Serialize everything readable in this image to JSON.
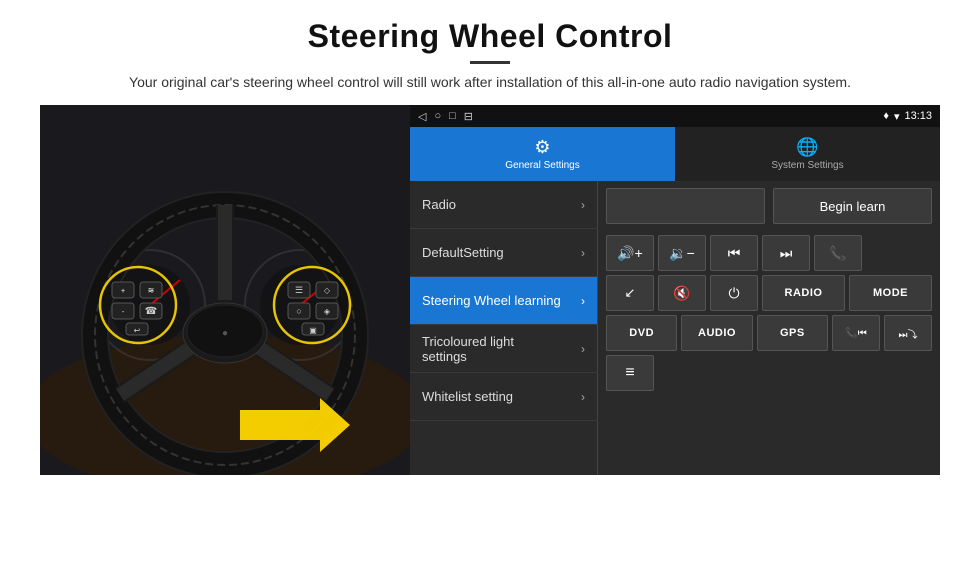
{
  "page": {
    "title": "Steering Wheel Control",
    "divider": true,
    "subtitle": "Your original car's steering wheel control will still work after installation of this all-in-one auto radio navigation system."
  },
  "status_bar": {
    "nav_icons": [
      "◁",
      "○",
      "□",
      "⊟"
    ],
    "right_icons": [
      "♦",
      "▾"
    ],
    "time": "13:13"
  },
  "tabs": [
    {
      "id": "general",
      "label": "General Settings",
      "active": true,
      "icon": "⚙"
    },
    {
      "id": "system",
      "label": "System Settings",
      "active": false,
      "icon": "🌐"
    }
  ],
  "menu_items": [
    {
      "id": "radio",
      "label": "Radio",
      "active": false
    },
    {
      "id": "default",
      "label": "DefaultSetting",
      "active": false
    },
    {
      "id": "steering",
      "label": "Steering Wheel learning",
      "active": true
    },
    {
      "id": "tricoloured",
      "label": "Tricoloured light settings",
      "active": false,
      "multiline": true
    },
    {
      "id": "whitelist",
      "label": "Whitelist setting",
      "active": false
    }
  ],
  "control_panel": {
    "begin_learn_label": "Begin learn",
    "rows": [
      [
        {
          "type": "icon",
          "icon": "◀◀+",
          "label": "vol-up",
          "symbol": "🔊+"
        },
        {
          "type": "icon",
          "icon": "◀◀-",
          "label": "vol-down",
          "symbol": "🔉"
        },
        {
          "type": "icon",
          "label": "prev-track",
          "symbol": "⏮"
        },
        {
          "type": "icon",
          "label": "next-track",
          "symbol": "⏭"
        },
        {
          "type": "icon",
          "label": "phone",
          "symbol": "📞"
        }
      ],
      [
        {
          "type": "icon",
          "label": "answer-call",
          "symbol": "↙"
        },
        {
          "type": "icon",
          "label": "mute",
          "symbol": "🔇"
        },
        {
          "type": "icon",
          "label": "power",
          "symbol": "⏻"
        },
        {
          "type": "text",
          "label": "radio-btn",
          "text": "RADIO"
        },
        {
          "type": "text",
          "label": "mode-btn",
          "text": "MODE"
        }
      ],
      [
        {
          "type": "text",
          "label": "dvd-btn",
          "text": "DVD"
        },
        {
          "type": "text",
          "label": "audio-btn",
          "text": "AUDIO"
        },
        {
          "type": "text",
          "label": "gps-btn",
          "text": "GPS"
        },
        {
          "type": "icon",
          "label": "phone-prev",
          "symbol": "📞⏮"
        },
        {
          "type": "icon",
          "label": "next-mixed",
          "symbol": "⏭⤵"
        }
      ],
      [
        {
          "type": "icon",
          "label": "menu-icon",
          "symbol": "≡"
        }
      ]
    ]
  }
}
